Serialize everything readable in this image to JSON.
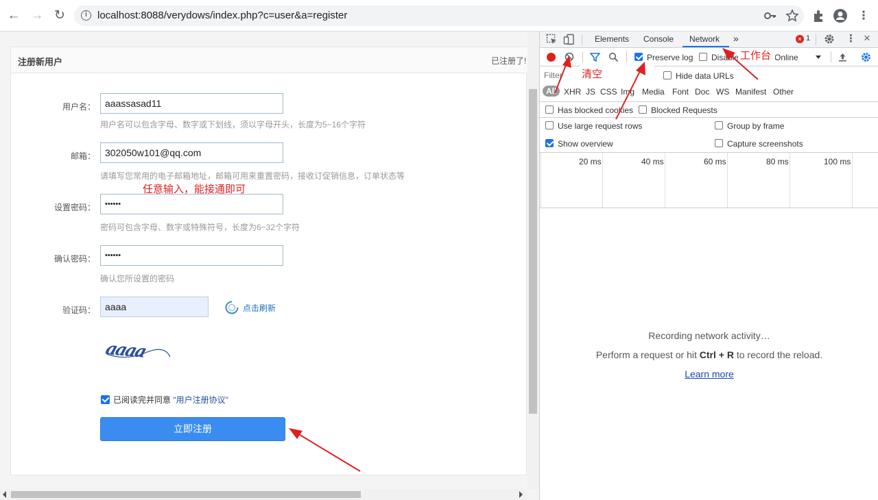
{
  "browser": {
    "url": "localhost:8088/verydows/index.php?c=user&a=register",
    "back": "←",
    "forward": "→",
    "reload": "↻"
  },
  "form": {
    "heading": "注册新用户",
    "already_registered": "已注册了!",
    "username": {
      "label": "用户名：",
      "value": "aaassasad11",
      "hint": "用户名可以包含字母、数字或下划线，须以字母开头，长度为5~16个字符"
    },
    "email": {
      "label": "邮箱：",
      "value": "302050w101@qq.com",
      "hint": "请填写您常用的电子邮箱地址，邮箱可用来重置密码，接收订促销信息，订单状态等"
    },
    "password": {
      "label": "设置密码：",
      "value": "••••••",
      "hint": "密码可包含字母、数字或特殊符号，长度为6~32个字符"
    },
    "confirm": {
      "label": "确认密码：",
      "value": "••••••",
      "hint": "确认您所设置的密码"
    },
    "captcha": {
      "label": "验证码：",
      "value": "aaaa",
      "refresh": "点击刷新",
      "image_text": "aaaa"
    },
    "agree_prefix": "已阅读完并同意 ",
    "agree_link": "\"用户注册协议\"",
    "agree_checked": true,
    "submit": "立即注册"
  },
  "annotations": {
    "any_input": "任意输入，能接通即可",
    "clear": "清空",
    "workbench": "工作台"
  },
  "devtools": {
    "tabs": [
      "Elements",
      "Console",
      "Network"
    ],
    "active_tab": "Network",
    "more": "»",
    "error_count": "1",
    "toolbar": {
      "preserve_log": "Preserve log",
      "disable_cache": "Disable cache",
      "throttle": "Online"
    },
    "filter_placeholder": "Filter",
    "hide_data_urls": "Hide data URLs",
    "types": [
      "All",
      "XHR",
      "JS",
      "CSS",
      "Img",
      "Media",
      "Font",
      "Doc",
      "WS",
      "Manifest",
      "Other"
    ],
    "has_blocked_cookies": "Has blocked cookies",
    "blocked_requests": "Blocked Requests",
    "use_large_rows": "Use large request rows",
    "group_by_frame": "Group by frame",
    "show_overview": "Show overview",
    "capture_screenshots": "Capture screenshots",
    "ticks": [
      "20 ms",
      "40 ms",
      "60 ms",
      "80 ms",
      "100 ms"
    ],
    "recording": "Recording network activity…",
    "perform_prefix": "Perform a request or hit ",
    "perform_keys": "Ctrl + R",
    "perform_suffix": " to record the reload.",
    "learn_more": "Learn more"
  },
  "colors": {
    "accent": "#1a73e8",
    "submit": "#3b8cf0",
    "annotation": "#e02020",
    "record": "#e0201a"
  }
}
